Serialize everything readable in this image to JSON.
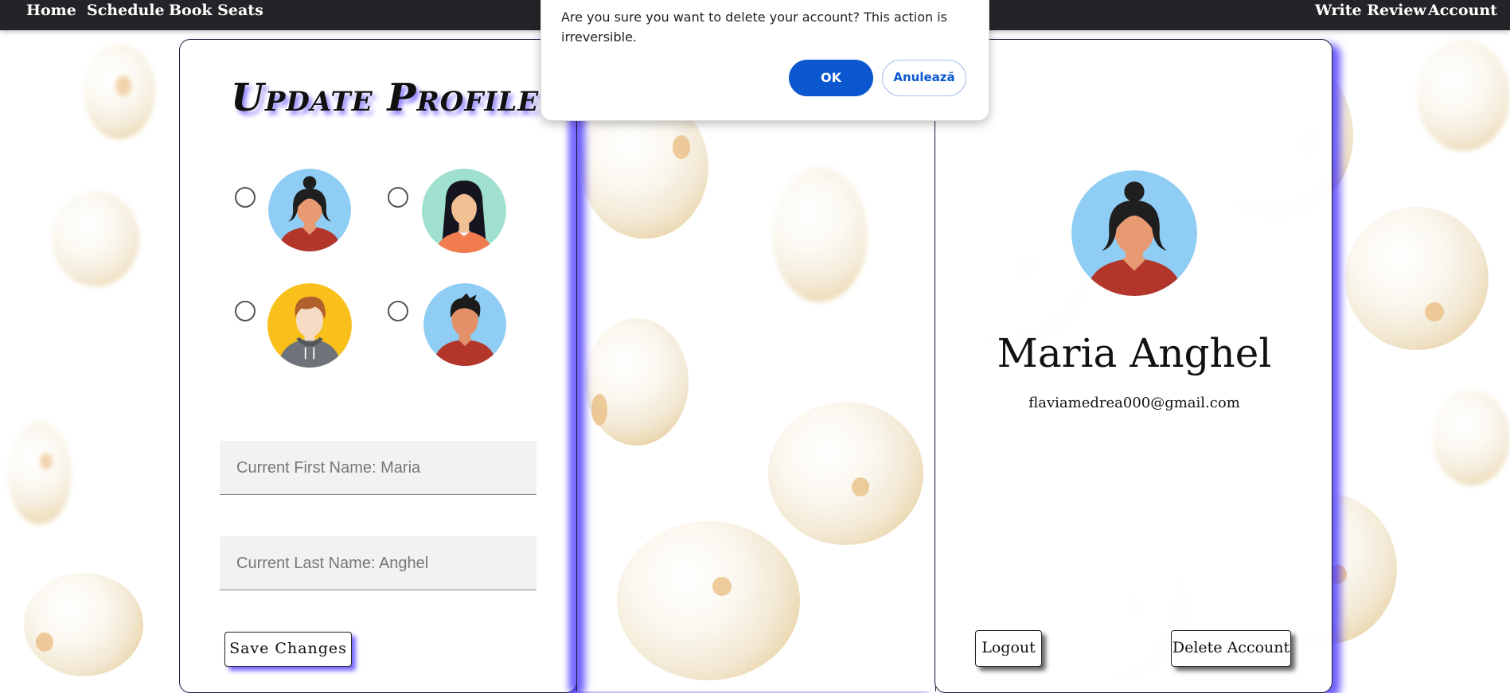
{
  "nav": {
    "home": "Home",
    "schedule": "Schedule",
    "book_seats": "Book Seats",
    "write_review": "Write Review",
    "account": "Account"
  },
  "update_profile": {
    "title": "Update Profile",
    "avatar_options": [
      "woman-bun-avatar",
      "woman-long-hair-avatar",
      "man-hoodie-avatar",
      "man-spiky-hair-avatar"
    ],
    "first_name_placeholder": "Current First Name: Maria",
    "last_name_placeholder": "Current Last Name: Anghel",
    "save_label": "Save Changes"
  },
  "profile": {
    "name": "Maria Anghel",
    "email": "flaviamedrea000@gmail.com",
    "logout_label": "Logout",
    "delete_label": "Delete Account"
  },
  "dialog": {
    "message": "Are you sure you want to delete your account? This action is irreversible.",
    "ok_label": "OK",
    "cancel_label": "Anulează"
  },
  "colors": {
    "navbar": "#232427",
    "accent_shadow": "#3c28ff",
    "dialog_ok": "#0b57d0"
  }
}
